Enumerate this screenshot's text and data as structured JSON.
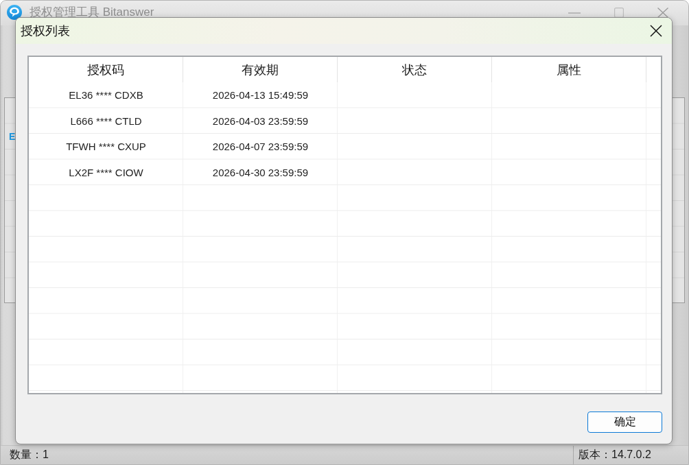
{
  "main_window": {
    "title": "授权管理工具 Bitanswer",
    "list_fragment": "E",
    "status_bar": {
      "count": "数量：1",
      "version": "版本：14.7.0.2"
    }
  },
  "dialog": {
    "title": "授权列表",
    "table": {
      "columns": [
        "授权码",
        "有效期",
        "状态",
        "属性"
      ],
      "rows": [
        [
          "EL36 **** CDXB",
          "2026-04-13 15:49:59"
        ],
        [
          "L666 **** CTLD",
          "2026-04-03 23:59:59"
        ],
        [
          "TFWH **** CXUP",
          "2026-04-07 23:59:59"
        ],
        [
          "LX2F **** CIOW",
          "2026-04-30 23:59:59"
        ]
      ]
    },
    "buttons": [
      "确定"
    ]
  }
}
